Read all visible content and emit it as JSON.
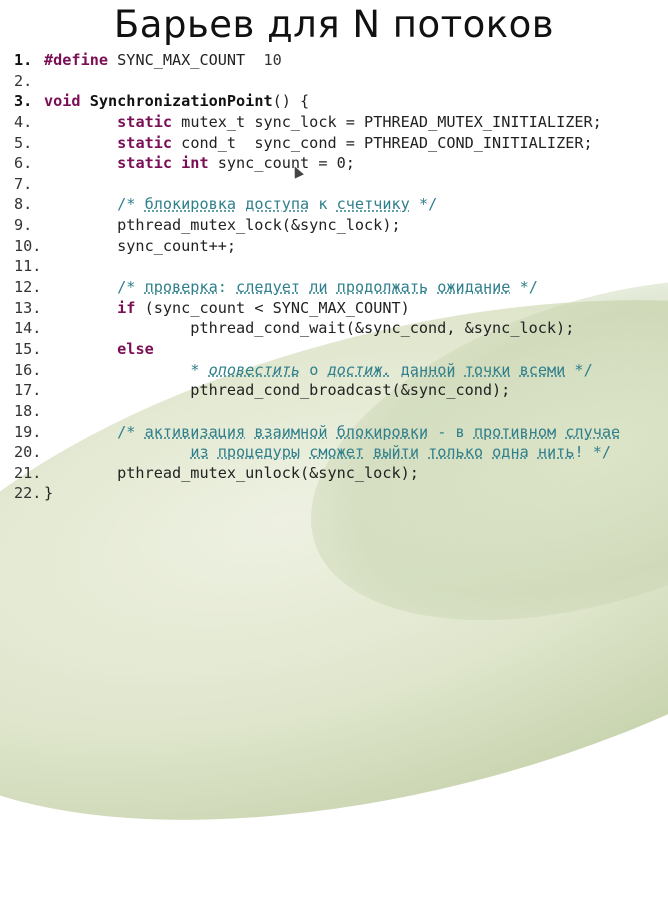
{
  "title": "Барьев для N потоков",
  "lines": [
    {
      "n": "1.",
      "segs": [
        [
          "kw",
          "#define"
        ],
        [
          "t",
          " SYNC_MAX_COUNT  "
        ],
        [
          "nl",
          "10"
        ]
      ]
    },
    {
      "n": "2.",
      "segs": []
    },
    {
      "n": "3.",
      "segs": [
        [
          "kw",
          "void"
        ],
        [
          "t",
          " "
        ],
        [
          "fn",
          "SynchronizationPoint"
        ],
        [
          "t",
          "() {"
        ]
      ]
    },
    {
      "n": "4.",
      "segs": [
        [
          "t",
          "        "
        ],
        [
          "kw",
          "static"
        ],
        [
          "t",
          " mutex_t sync_lock = PTHREAD_MUTEX_INITIALIZER;"
        ]
      ]
    },
    {
      "n": "5.",
      "segs": [
        [
          "t",
          "        "
        ],
        [
          "kw",
          "static"
        ],
        [
          "t",
          " cond_t  sync_cond = PTHREAD_COND_INITIALIZER;"
        ]
      ]
    },
    {
      "n": "6.",
      "segs": [
        [
          "t",
          "        "
        ],
        [
          "kw",
          "static int"
        ],
        [
          "t",
          " sync_count = 0;"
        ]
      ]
    },
    {
      "n": "7.",
      "segs": []
    },
    {
      "n": "8.",
      "segs": [
        [
          "t",
          "        "
        ],
        [
          "cm",
          "/* "
        ],
        [
          "cu",
          "блокировка"
        ],
        [
          "cm",
          " "
        ],
        [
          "cu",
          "доступа"
        ],
        [
          "cm",
          " к "
        ],
        [
          "cu",
          "счетчику"
        ],
        [
          "cm",
          " */"
        ]
      ]
    },
    {
      "n": "9.",
      "segs": [
        [
          "t",
          "        pthread_mutex_lock(&sync_lock);"
        ]
      ]
    },
    {
      "n": "10.",
      "segs": [
        [
          "t",
          "        sync_count++;"
        ]
      ]
    },
    {
      "n": "11.",
      "segs": []
    },
    {
      "n": "12.",
      "segs": [
        [
          "t",
          "        "
        ],
        [
          "cm",
          "/* "
        ],
        [
          "cu",
          "проверка"
        ],
        [
          "cm",
          ": "
        ],
        [
          "cu",
          "следует"
        ],
        [
          "cm",
          " "
        ],
        [
          "cu",
          "ли"
        ],
        [
          "cm",
          " "
        ],
        [
          "cu",
          "продолжать"
        ],
        [
          "cm",
          " "
        ],
        [
          "cu",
          "ожидание"
        ],
        [
          "cm",
          " */"
        ]
      ]
    },
    {
      "n": "13.",
      "segs": [
        [
          "t",
          "        "
        ],
        [
          "kw",
          "if"
        ],
        [
          "t",
          " (sync_count < SYNC_MAX_COUNT)"
        ]
      ]
    },
    {
      "n": "14.",
      "segs": [
        [
          "t",
          "                pthread_cond_wait(&sync_cond, &sync_lock);"
        ]
      ]
    },
    {
      "n": "15.",
      "segs": [
        [
          "t",
          "        "
        ],
        [
          "kw",
          "else"
        ]
      ]
    },
    {
      "n": "16.",
      "segs": [
        [
          "t",
          "                "
        ],
        [
          "cm",
          "* "
        ],
        [
          "ci",
          "оповестить"
        ],
        [
          "cm",
          " о "
        ],
        [
          "ci",
          "достиж."
        ],
        [
          "cm",
          " "
        ],
        [
          "cu",
          "данной"
        ],
        [
          "cm",
          " "
        ],
        [
          "cu",
          "точки"
        ],
        [
          "cm",
          " "
        ],
        [
          "cu",
          "всеми"
        ],
        [
          "cm",
          " */"
        ]
      ]
    },
    {
      "n": "17.",
      "segs": [
        [
          "t",
          "                pthread_cond_broadcast(&sync_cond);"
        ]
      ]
    },
    {
      "n": "18.",
      "segs": []
    },
    {
      "n": "19.",
      "segs": [
        [
          "t",
          "        "
        ],
        [
          "cm",
          "/* "
        ],
        [
          "cu",
          "активизация"
        ],
        [
          "cm",
          " "
        ],
        [
          "cu",
          "взаимной"
        ],
        [
          "cm",
          " "
        ],
        [
          "cu",
          "блокировки"
        ],
        [
          "cm",
          " - в "
        ],
        [
          "cu",
          "противном"
        ],
        [
          "cm",
          " "
        ],
        [
          "cu",
          "случае"
        ]
      ]
    },
    {
      "n": "20.",
      "segs": [
        [
          "t",
          "                "
        ],
        [
          "cu",
          "из"
        ],
        [
          "cm",
          " "
        ],
        [
          "cu",
          "процедуры"
        ],
        [
          "cm",
          " "
        ],
        [
          "cu",
          "сможет"
        ],
        [
          "cm",
          " "
        ],
        [
          "cu",
          "выйти"
        ],
        [
          "cm",
          " "
        ],
        [
          "cu",
          "только"
        ],
        [
          "cm",
          " "
        ],
        [
          "cu",
          "одна"
        ],
        [
          "cm",
          " "
        ],
        [
          "cu",
          "нить"
        ],
        [
          "cm",
          "! */"
        ]
      ]
    },
    {
      "n": "21.",
      "segs": [
        [
          "t",
          "        pthread_mutex_unlock(&sync_lock);"
        ]
      ]
    },
    {
      "n": "22.",
      "segs": [
        [
          "t",
          "}"
        ]
      ]
    }
  ]
}
